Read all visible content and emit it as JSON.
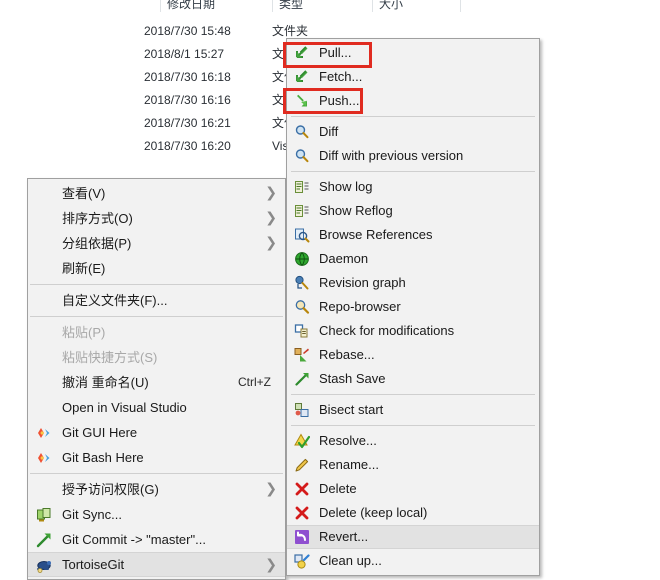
{
  "explorer": {
    "columns": [
      "修改日期",
      "类型",
      "大小",
      ""
    ],
    "rows": [
      {
        "date": "2018/7/30 15:48",
        "type": "文件夹"
      },
      {
        "date": "2018/8/1 15:27",
        "type": "文件夹"
      },
      {
        "date": "2018/7/30 16:18",
        "type": "文件夹"
      },
      {
        "date": "2018/7/30 16:16",
        "type": "文件夹"
      },
      {
        "date": "2018/7/30 16:21",
        "type": "文件夹"
      },
      {
        "date": "2018/7/30 16:20",
        "type": "Visual Studio"
      }
    ]
  },
  "left_menu": {
    "items": [
      {
        "label": "查看(V)",
        "icon": "",
        "submenu": true,
        "disabled": false,
        "selected": false,
        "accel": ""
      },
      {
        "label": "排序方式(O)",
        "icon": "",
        "submenu": true,
        "disabled": false,
        "selected": false,
        "accel": ""
      },
      {
        "label": "分组依据(P)",
        "icon": "",
        "submenu": true,
        "disabled": false,
        "selected": false,
        "accel": ""
      },
      {
        "label": "刷新(E)",
        "icon": "",
        "submenu": false,
        "disabled": false,
        "selected": false,
        "accel": ""
      },
      {
        "separator": true
      },
      {
        "label": "自定义文件夹(F)...",
        "icon": "",
        "submenu": false,
        "disabled": false,
        "selected": false,
        "accel": ""
      },
      {
        "separator": true
      },
      {
        "label": "粘贴(P)",
        "icon": "",
        "submenu": false,
        "disabled": true,
        "selected": false,
        "accel": ""
      },
      {
        "label": "粘贴快捷方式(S)",
        "icon": "",
        "submenu": false,
        "disabled": true,
        "selected": false,
        "accel": ""
      },
      {
        "label": "撤消 重命名(U)",
        "icon": "",
        "submenu": false,
        "disabled": false,
        "selected": false,
        "accel": "Ctrl+Z"
      },
      {
        "label": "Open in Visual Studio",
        "icon": "",
        "submenu": false,
        "disabled": false,
        "selected": false,
        "accel": ""
      },
      {
        "label": "Git GUI Here",
        "icon": "git-logo-icon",
        "submenu": false,
        "disabled": false,
        "selected": false,
        "accel": ""
      },
      {
        "label": "Git Bash Here",
        "icon": "git-logo-icon",
        "submenu": false,
        "disabled": false,
        "selected": false,
        "accel": ""
      },
      {
        "separator": true
      },
      {
        "label": "授予访问权限(G)",
        "icon": "",
        "submenu": true,
        "disabled": false,
        "selected": false,
        "accel": ""
      },
      {
        "label": "Git Sync...",
        "icon": "git-sync-icon",
        "submenu": false,
        "disabled": false,
        "selected": false,
        "accel": ""
      },
      {
        "label": "Git Commit -> \"master\"...",
        "icon": "commit-arrow-icon",
        "submenu": false,
        "disabled": false,
        "selected": false,
        "accel": ""
      },
      {
        "label": "TortoiseGit",
        "icon": "tortoise-icon",
        "submenu": true,
        "disabled": false,
        "selected": true,
        "accel": ""
      }
    ]
  },
  "right_menu": {
    "items": [
      {
        "label": "Pull...",
        "icon": "pull-arrow-icon",
        "selected": false
      },
      {
        "label": "Fetch...",
        "icon": "fetch-arrow-icon",
        "selected": false
      },
      {
        "label": "Push...",
        "icon": "push-arrow-icon",
        "selected": false
      },
      {
        "separator": true
      },
      {
        "label": "Diff",
        "icon": "magnifier-icon",
        "selected": false
      },
      {
        "label": "Diff with previous version",
        "icon": "magnifier-icon",
        "selected": false
      },
      {
        "separator": true
      },
      {
        "label": "Show log",
        "icon": "log-icon",
        "selected": false
      },
      {
        "label": "Show Reflog",
        "icon": "log-icon",
        "selected": false
      },
      {
        "label": "Browse References",
        "icon": "browse-refs-icon",
        "selected": false
      },
      {
        "label": "Daemon",
        "icon": "globe-icon",
        "selected": false
      },
      {
        "label": "Revision graph",
        "icon": "revision-graph-icon",
        "selected": false
      },
      {
        "label": "Repo-browser",
        "icon": "repo-browser-icon",
        "selected": false
      },
      {
        "label": "Check for modifications",
        "icon": "check-mods-icon",
        "selected": false
      },
      {
        "label": "Rebase...",
        "icon": "rebase-icon",
        "selected": false
      },
      {
        "label": "Stash Save",
        "icon": "stash-icon",
        "selected": false
      },
      {
        "separator": true
      },
      {
        "label": "Bisect start",
        "icon": "bisect-icon",
        "selected": false
      },
      {
        "separator": true
      },
      {
        "label": "Resolve...",
        "icon": "resolve-icon",
        "selected": false
      },
      {
        "label": "Rename...",
        "icon": "pencil-icon",
        "selected": false
      },
      {
        "label": "Delete",
        "icon": "delete-x-icon",
        "selected": false
      },
      {
        "label": "Delete (keep local)",
        "icon": "delete-x-icon",
        "selected": false
      },
      {
        "label": "Revert...",
        "icon": "revert-icon",
        "selected": true
      },
      {
        "label": "Clean up...",
        "icon": "cleanup-icon",
        "selected": false
      }
    ]
  },
  "annotations": {
    "color": "#e02b20",
    "boxes": [
      "Pull...",
      "Push..."
    ]
  },
  "submenu_arrow": "❯"
}
